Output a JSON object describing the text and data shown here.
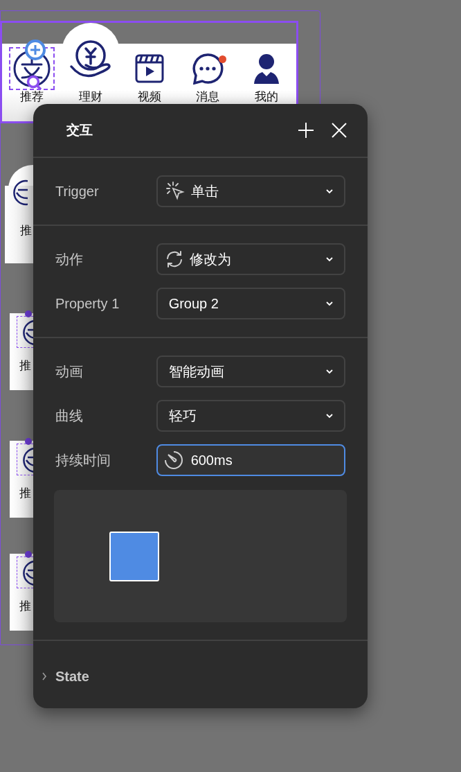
{
  "canvas": {
    "tab_bar": {
      "items": [
        {
          "label": "推荐",
          "selected": true,
          "dot": false
        },
        {
          "label": "理财",
          "selected": false,
          "dot": false
        },
        {
          "label": "视频",
          "selected": false,
          "dot": false
        },
        {
          "label": "消息",
          "selected": false,
          "dot": true
        },
        {
          "label": "我的",
          "selected": false,
          "dot": false
        }
      ]
    },
    "variants": [
      {
        "label": "推"
      },
      {
        "label": "推"
      },
      {
        "label": "推"
      },
      {
        "label": "推"
      }
    ]
  },
  "panel": {
    "title": "交互",
    "sections": [
      {
        "rows": [
          {
            "label": "Trigger",
            "kind": "select",
            "value": "单击"
          }
        ]
      },
      {
        "rows": [
          {
            "label": "动作",
            "kind": "select",
            "value": "修改为"
          },
          {
            "label": "Property 1",
            "kind": "select",
            "value": "Group 2"
          }
        ]
      },
      {
        "rows": [
          {
            "label": "动画",
            "kind": "select",
            "value": "智能动画"
          },
          {
            "label": "曲线",
            "kind": "select",
            "value": "轻巧"
          },
          {
            "label": "持续时间",
            "kind": "field",
            "value": "600ms",
            "focused": true
          }
        ]
      }
    ],
    "footer": {
      "label": "State",
      "expanded": false
    }
  }
}
